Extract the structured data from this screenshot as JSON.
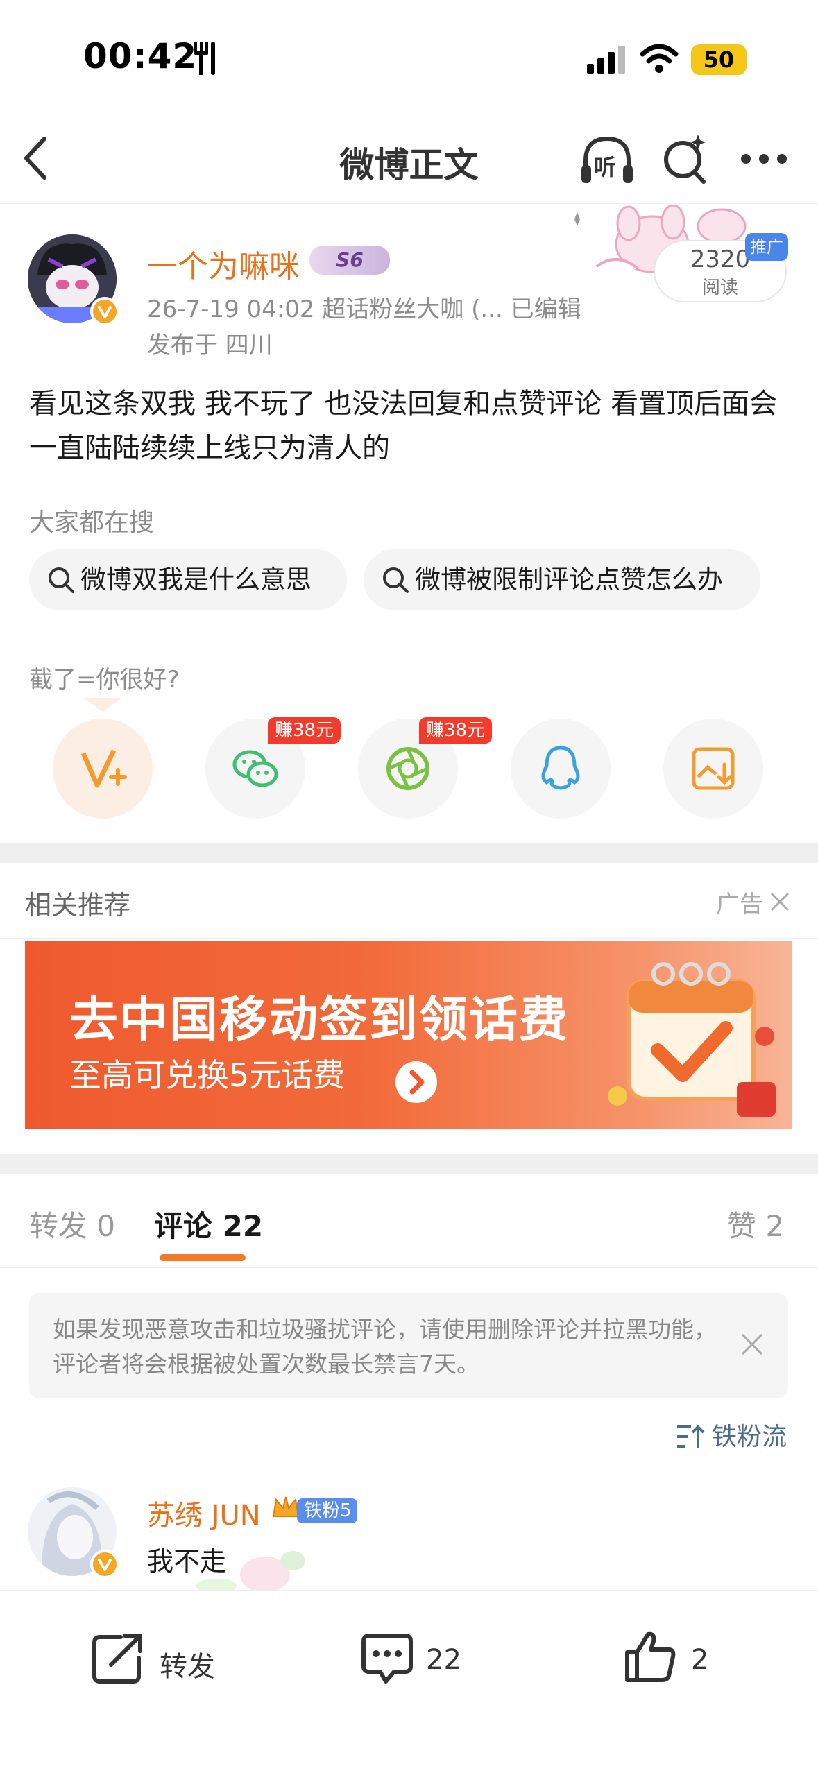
{
  "status_bar": {
    "time": "00:42",
    "battery": "50"
  },
  "navbar": {
    "title": "微博正文",
    "listen_label": "听"
  },
  "post": {
    "username": "一个为嘛咪",
    "level_badge": "S6",
    "meta": "26-7-19 04:02  超话粉丝大咖 (...  已编辑",
    "location": "发布于 四川",
    "read_count": "2320",
    "read_label": "阅读",
    "promo_tag": "推广",
    "body": "看见这条双我 我不玩了 也没法回复和点赞评论 看置顶后面会一直陆陆续续上线只为清人的"
  },
  "search": {
    "heading": "大家都在搜",
    "chips": [
      "微博双我是什么意思",
      "微博被限制评论点赞怎么办"
    ]
  },
  "tagline": "截了=你很好?",
  "share": {
    "icons": [
      "vplus-icon",
      "wechat-icon",
      "moments-icon",
      "qq-icon",
      "save-image-icon"
    ],
    "wechat_badge": "赚38元",
    "moments_badge": "赚38元"
  },
  "related": {
    "heading": "相关推荐",
    "ad_label": "广告",
    "banner_title": "去中国移动签到领话费",
    "banner_sub": "至高可兑换5元话费"
  },
  "tabs": {
    "repost_label": "转发",
    "repost_count": "0",
    "comment_label": "评论",
    "comment_count": "22",
    "like_label": "赞",
    "like_count": "2"
  },
  "notice": {
    "text": "如果发现恶意攻击和垃圾骚扰评论，请使用删除评论并拉黑功能，评论者将会根据被处置次数最长禁言7天。"
  },
  "sort": {
    "label": "铁粉流"
  },
  "comment": {
    "username": "苏绣 JUN",
    "badge": "铁粉5",
    "text": "我不走"
  },
  "bottom_bar": {
    "repost_label": "转发",
    "comment_count": "22",
    "like_count": "2"
  },
  "colors": {
    "accent_orange": "#e8711a",
    "tab_underline": "#f27b23",
    "earn_badge": "#f23b2b",
    "wechat_green": "#3fbf72",
    "qq_blue": "#39a2e0",
    "save_orange": "#f39b2e"
  }
}
